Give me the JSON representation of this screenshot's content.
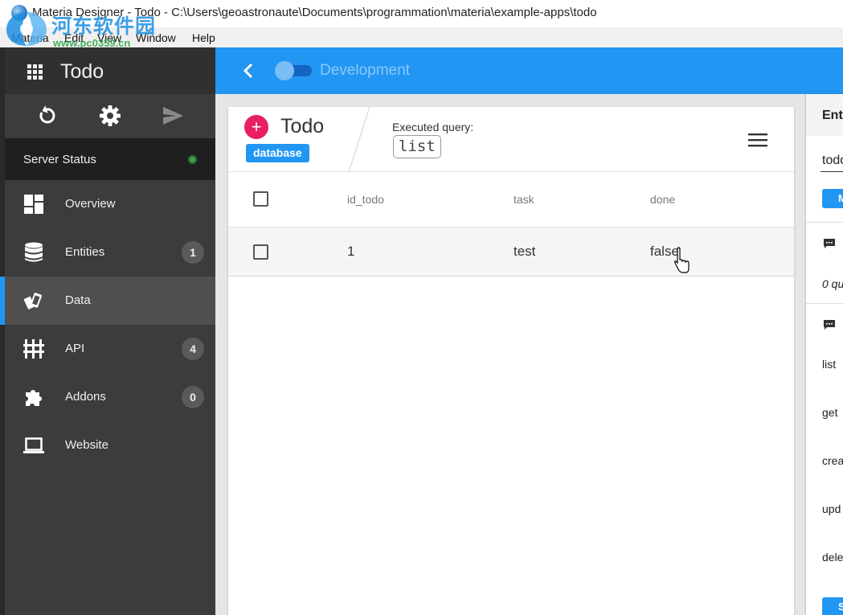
{
  "window": {
    "title": "Materia Designer - Todo - C:\\Users\\geoastronaute\\Documents\\programmation\\materia\\example-apps\\todo"
  },
  "watermark": {
    "name": "河东软件园",
    "url": "www.pc0359.cn"
  },
  "menu": [
    "Materia",
    "Edit",
    "View",
    "Window",
    "Help"
  ],
  "sidebar": {
    "app_name": "Todo",
    "server_status_label": "Server Status",
    "server_status_color": "#3fa14f",
    "items": [
      {
        "label": "Overview",
        "icon": "dashboard-icon",
        "badge": ""
      },
      {
        "label": "Entities",
        "icon": "database-icon",
        "badge": "1"
      },
      {
        "label": "Data",
        "icon": "cards-icon",
        "badge": "",
        "active": true
      },
      {
        "label": "API",
        "icon": "api-icon",
        "badge": "4"
      },
      {
        "label": "Addons",
        "icon": "puzzle-icon",
        "badge": "0"
      },
      {
        "label": "Website",
        "icon": "laptop-icon",
        "badge": ""
      }
    ]
  },
  "topbar": {
    "environment": "Development",
    "accent": "#2196f3"
  },
  "card": {
    "title": "Todo",
    "tag": "database",
    "executed_query_label": "Executed query:",
    "executed_query": "list",
    "columns": [
      "id_todo",
      "task",
      "done"
    ],
    "rows": [
      {
        "id_todo": "1",
        "task": "test",
        "done": "false"
      }
    ]
  },
  "right_panel": {
    "header": "Enti",
    "entity": "todo",
    "button": "M",
    "queries_text": "0 qu",
    "api_items": [
      "list",
      "get",
      "crea",
      "upd",
      "dele"
    ],
    "bottom_button": "S"
  }
}
